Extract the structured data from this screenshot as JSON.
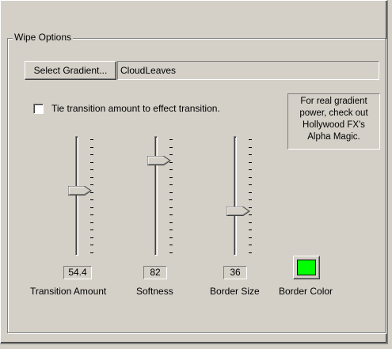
{
  "window": {
    "group_title": "Wipe Options"
  },
  "gradient": {
    "button_label": "Select Gradient...",
    "value": "CloudLeaves"
  },
  "tie_checkbox": {
    "label": "Tie transition amount to effect transition.",
    "checked": false
  },
  "info": {
    "lines": [
      "For real gradient",
      "power, check out",
      "Hollywood FX's",
      "Alpha Magic."
    ]
  },
  "sliders": [
    {
      "id": "transition-amount",
      "label": "Transition Amount",
      "value": "54.4",
      "level": 0.544
    },
    {
      "id": "softness",
      "label": "Softness",
      "value": "82",
      "level": 0.82
    },
    {
      "id": "border-size",
      "label": "Border Size",
      "value": "36",
      "level": 0.36
    }
  ],
  "border_color": {
    "label": "Border Color",
    "color": "#00ff00"
  },
  "colors": {
    "face": "#d4d0c8",
    "swatch": "#00ff00"
  }
}
